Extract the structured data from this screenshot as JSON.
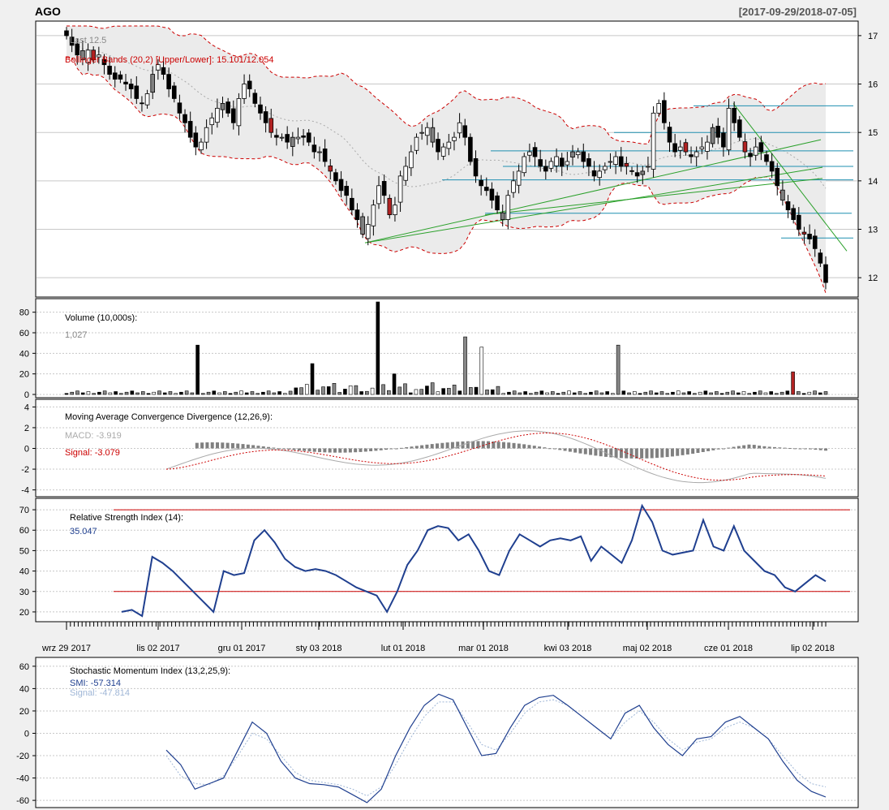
{
  "header": {
    "symbol": "AGO",
    "date_range": "[2017-09-29/2018-07-05]"
  },
  "colors": {
    "background": "#f0f0f0",
    "panel": "#ffffff",
    "bb_band": "#cc0000",
    "bb_fill": "#ebebeb",
    "up_candle": "#ffffff",
    "down_candle": "#000000",
    "red_candle": "#b22222",
    "grey_candle": "#808080",
    "hline": "#1f8fb0",
    "trendline": "#2aa02a",
    "macd_hist": "#808080",
    "signal": "#cc0000",
    "rsi": "#1f3f8f",
    "smi": "#1f3f8f",
    "smi_signal": "#9fb6d6"
  },
  "chart_data": [
    {
      "type": "candlestick",
      "panel": "price",
      "labels": [
        "Last 12.5",
        "Bollinger Bands (20,2) [Upper/Lower]: 15.101/12.054"
      ],
      "ylim": [
        11.6,
        17.3
      ],
      "yticks": [
        12,
        13,
        14,
        15,
        16,
        17
      ],
      "grid": true,
      "xtick_labels": [
        "wrz 29 2017",
        "lis 02 2017",
        "gru 01 2017",
        "sty 03 2018",
        "lut 01 2018",
        "mar 01 2018",
        "kwi 03 2018",
        "maj 02 2018",
        "cze 01 2018",
        "lip 02 2018"
      ],
      "close": [
        17.0,
        16.8,
        16.6,
        16.5,
        16.7,
        16.5,
        16.6,
        16.4,
        16.2,
        16.1,
        16.1,
        16.0,
        15.9,
        15.7,
        15.6,
        15.8,
        16.2,
        16.4,
        16.2,
        15.9,
        15.7,
        15.4,
        15.2,
        14.9,
        14.7,
        14.8,
        15.1,
        15.3,
        15.5,
        15.6,
        15.4,
        15.2,
        15.7,
        16.0,
        15.9,
        15.6,
        15.4,
        15.2,
        15.0,
        14.9,
        14.9,
        14.8,
        14.9,
        14.9,
        14.9,
        14.8,
        14.6,
        14.6,
        14.4,
        14.2,
        14.0,
        13.8,
        13.7,
        13.4,
        13.2,
        12.9,
        13.1,
        13.5,
        13.9,
        13.7,
        13.3,
        13.5,
        14.1,
        14.3,
        14.6,
        14.9,
        15.0,
        15.1,
        14.8,
        14.6,
        14.7,
        14.8,
        14.9,
        15.2,
        14.9,
        14.4,
        14.1,
        13.9,
        13.8,
        13.6,
        13.4,
        13.2,
        13.7,
        14.0,
        14.2,
        14.5,
        14.6,
        14.5,
        14.3,
        14.2,
        14.4,
        14.5,
        14.3,
        14.4,
        14.6,
        14.6,
        14.4,
        14.3,
        14.1,
        14.2,
        14.3,
        14.4,
        14.5,
        14.3,
        14.3,
        14.2,
        14.1,
        14.2,
        14.3,
        15.4,
        15.6,
        15.2,
        14.8,
        14.6,
        14.7,
        14.6,
        14.5,
        14.6,
        14.7,
        14.8,
        15.1,
        14.9,
        14.7,
        15.5,
        15.2,
        14.9,
        14.6,
        14.5,
        14.7,
        14.6,
        14.4,
        14.2,
        13.9,
        13.6,
        13.4,
        13.2,
        13.0,
        12.9,
        12.8,
        12.6,
        12.3,
        11.9
      ],
      "volume_10000s_latest": "1,027"
    },
    {
      "type": "bar",
      "panel": "volume",
      "labels": [
        "Volume (10,000s):",
        "1,027"
      ],
      "ylim": [
        0,
        90
      ],
      "yticks": [
        0,
        20,
        40,
        60,
        80
      ],
      "spikes": [
        {
          "index": 24,
          "value": 48
        },
        {
          "index": 45,
          "value": 30
        },
        {
          "index": 57,
          "value": 90
        },
        {
          "index": 60,
          "value": 20
        },
        {
          "index": 73,
          "value": 56
        },
        {
          "index": 76,
          "value": 46
        },
        {
          "index": 101,
          "value": 48
        },
        {
          "index": 133,
          "value": 22
        }
      ]
    },
    {
      "type": "bar+line",
      "panel": "macd",
      "labels": [
        "Moving Average Convergence Divergence (12,26,9):",
        "MACD: -3.919",
        "Signal: -3.079"
      ],
      "ylim": [
        -4.5,
        4.5
      ],
      "yticks": [
        -4,
        -2,
        0,
        2,
        4
      ]
    },
    {
      "type": "line",
      "panel": "rsi",
      "labels": [
        "Relative Strength Index (14):",
        "35.047"
      ],
      "ylim": [
        16,
        74
      ],
      "yticks": [
        20,
        30,
        40,
        50,
        60,
        70
      ],
      "hlines": [
        30,
        70
      ],
      "values": [
        20,
        21,
        18,
        47,
        44,
        40,
        35,
        30,
        25,
        20,
        40,
        38,
        39,
        55,
        60,
        54,
        46,
        42,
        40,
        41,
        40,
        38,
        35,
        32,
        30,
        28,
        20,
        30,
        43,
        50,
        60,
        62,
        61,
        55,
        58,
        50,
        40,
        38,
        50,
        58,
        55,
        52,
        55,
        56,
        55,
        57,
        45,
        52,
        48,
        44,
        55,
        72,
        64,
        50,
        48,
        49,
        50,
        65,
        52,
        50,
        62,
        50,
        45,
        40,
        38,
        32,
        30,
        34,
        38,
        35
      ]
    },
    {
      "type": "line",
      "panel": "smi",
      "labels": [
        "Stochastic Momentum Index (13,2,25,9):",
        "SMI: -57.314",
        "Signal: -47.814"
      ],
      "ylim": [
        -65,
        65
      ],
      "yticks": [
        -60,
        -40,
        -20,
        0,
        20,
        40,
        60
      ],
      "smi": [
        -15,
        -28,
        -50,
        -45,
        -40,
        -15,
        10,
        0,
        -25,
        -40,
        -45,
        -46,
        -48,
        -55,
        -62,
        -50,
        -20,
        5,
        25,
        35,
        30,
        5,
        -20,
        -18,
        5,
        25,
        32,
        34,
        25,
        15,
        5,
        -5,
        18,
        25,
        5,
        -10,
        -20,
        -5,
        -3,
        10,
        15,
        5,
        -5,
        -25,
        -42,
        -52,
        -57
      ],
      "signal": [
        -20,
        -38,
        -45,
        -46,
        -38,
        -20,
        0,
        -5,
        -20,
        -35,
        -42,
        -44,
        -46,
        -50,
        -56,
        -48,
        -28,
        -5,
        15,
        28,
        28,
        10,
        -10,
        -15,
        0,
        18,
        28,
        30,
        25,
        15,
        5,
        -5,
        10,
        20,
        10,
        -5,
        -15,
        -8,
        -5,
        5,
        10,
        5,
        -5,
        -20,
        -35,
        -45,
        -48
      ]
    }
  ]
}
